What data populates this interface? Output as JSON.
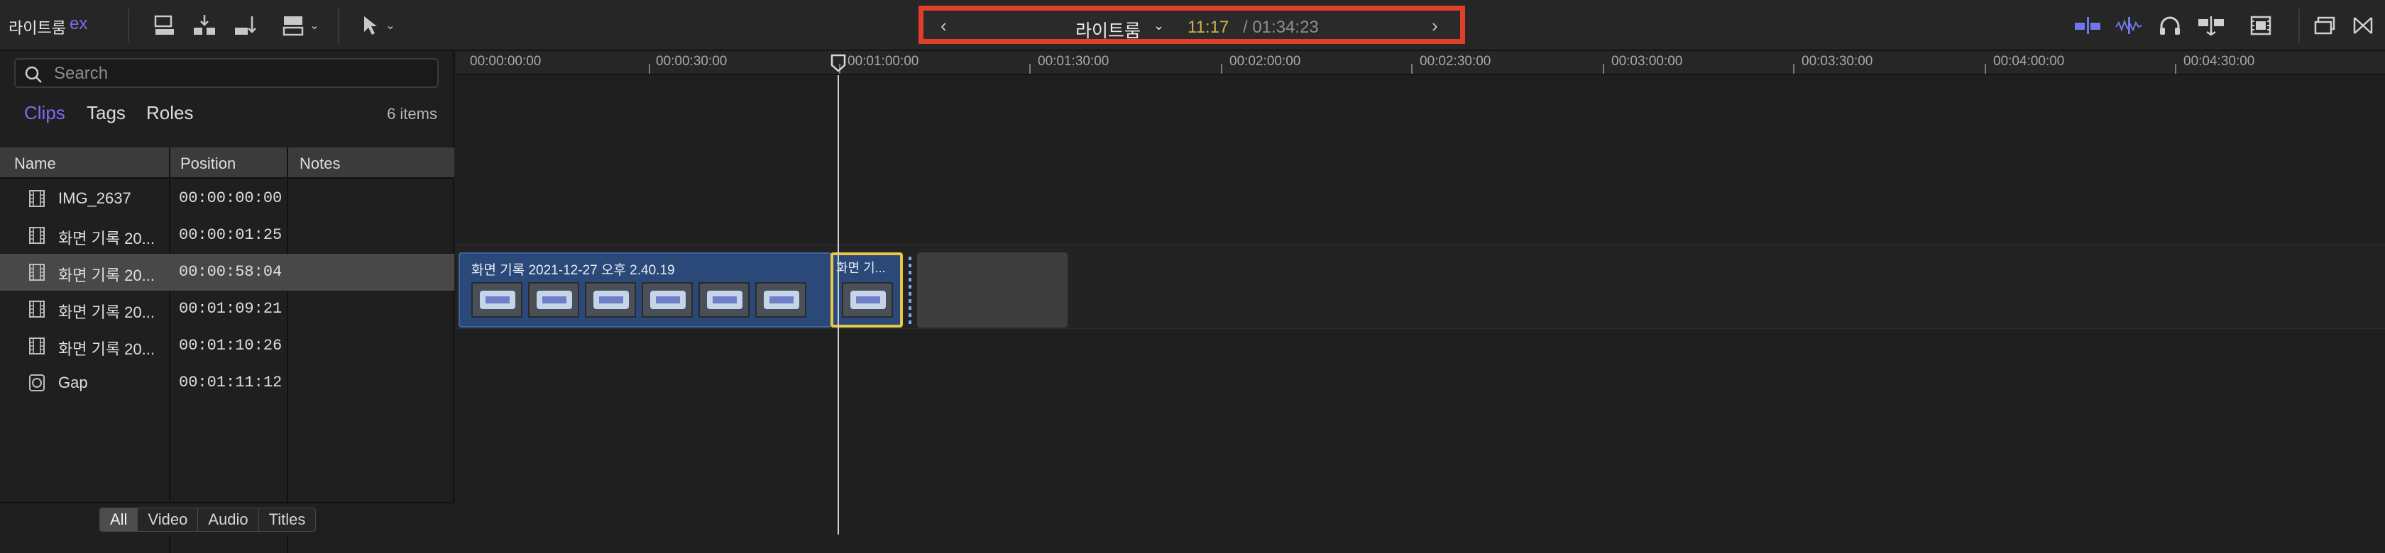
{
  "library": {
    "title": "라이트룸",
    "suffix": "ex"
  },
  "toolbar": {
    "icons": [
      "connect-clip-icon",
      "insert-clip-icon",
      "append-clip-icon",
      "overwrite-clip-icon",
      "select-tool-icon"
    ]
  },
  "navigator": {
    "project": "라이트룸",
    "current_time": "11:17",
    "total_time": "/ 01:34:23",
    "prev_label": "‹",
    "next_label": "›"
  },
  "right_toolbar": [
    "skimming-icon",
    "audio-skimming-icon",
    "solo-icon",
    "snapping-icon",
    "clip-appearance-icon",
    "fullscreen-icon",
    "inspector-icon"
  ],
  "search": {
    "placeholder": "Search",
    "value": ""
  },
  "tabs": [
    {
      "label": "Clips",
      "active": true
    },
    {
      "label": "Tags",
      "active": false
    },
    {
      "label": "Roles",
      "active": false
    }
  ],
  "items_count": "6 items",
  "columns": [
    "Name",
    "Position",
    "Notes"
  ],
  "rows": [
    {
      "name": "IMG_2637",
      "position": "00:00:00:00",
      "selected": false,
      "icon": "film-icon"
    },
    {
      "name": "화면 기록 20...",
      "position": "00:00:01:25",
      "selected": false,
      "icon": "film-icon"
    },
    {
      "name": "화면 기록 20...",
      "position": "00:00:58:04",
      "selected": true,
      "icon": "film-icon"
    },
    {
      "name": "화면 기록 20...",
      "position": "00:01:09:21",
      "selected": false,
      "icon": "film-icon"
    },
    {
      "name": "화면 기록 20...",
      "position": "00:01:10:26",
      "selected": false,
      "icon": "film-icon"
    },
    {
      "name": "Gap",
      "position": "00:01:11:12",
      "selected": false,
      "icon": "gap-icon"
    }
  ],
  "filters": [
    "All",
    "Video",
    "Audio",
    "Titles"
  ],
  "ruler": [
    "00:00:00:00",
    "00:00:30:00",
    "00:01:00:00",
    "00:01:30:00",
    "00:02:00:00",
    "00:02:30:00",
    "00:03:00:00",
    "00:03:30:00",
    "00:04:00:00",
    "00:04:30:00"
  ],
  "timeline": {
    "clip1_label": "화면 기록 2021-12-27 오후 2.40.19",
    "clip2_label": "화면 기..."
  },
  "colors": {
    "accent": "#7b6cf0",
    "nav_highlight": "#e0402a",
    "clip": "#2b4978",
    "selected_clip_border": "#e7c948",
    "timecode": "#d2b04c"
  }
}
